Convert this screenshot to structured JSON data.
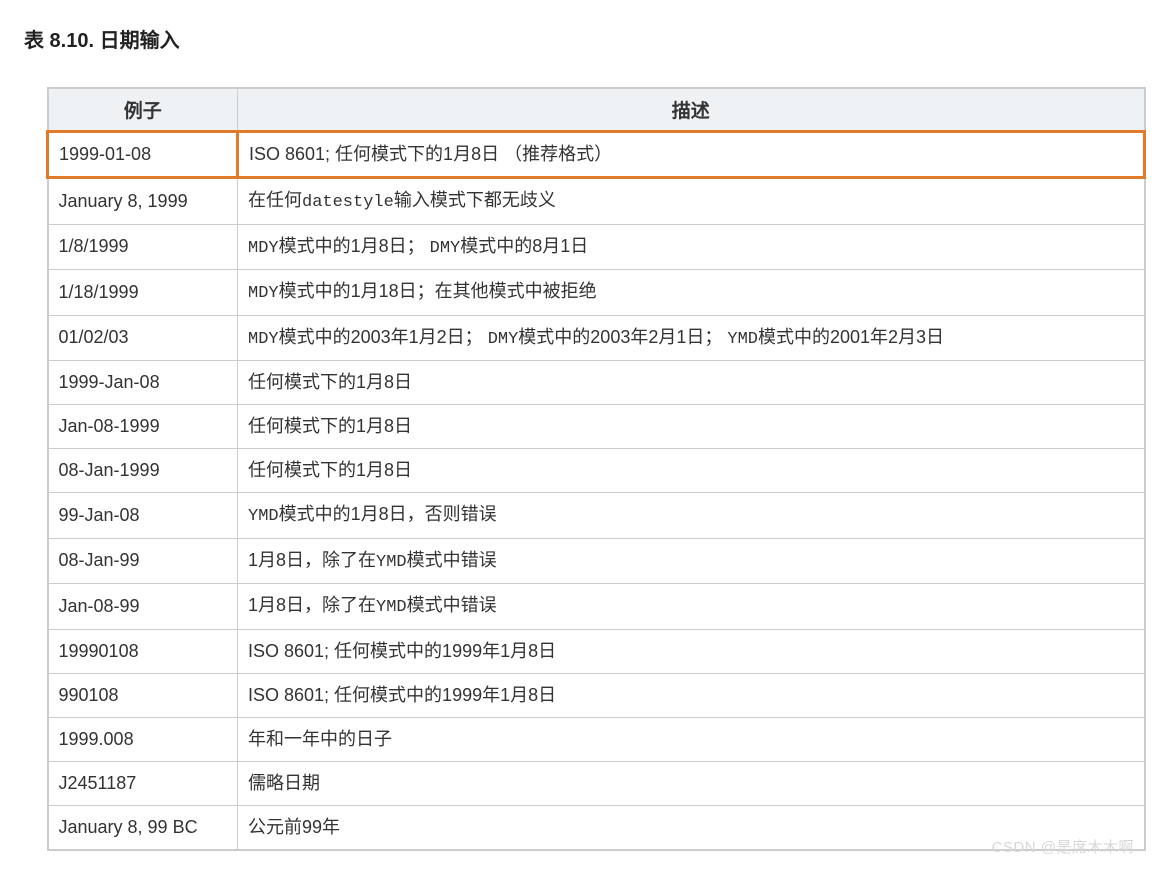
{
  "title": "表 8.10. 日期输入",
  "headers": {
    "example": "例子",
    "description": "描述"
  },
  "rows": [
    {
      "example": "1999-01-08",
      "desc": [
        {
          "t": "ISO 8601; 任何模式下的1月8日 （推荐格式）"
        }
      ],
      "highlight": true
    },
    {
      "example": "January 8, 1999",
      "desc": [
        {
          "t": "在任何"
        },
        {
          "t": "datestyle",
          "code": true
        },
        {
          "t": "输入模式下都无歧义"
        }
      ]
    },
    {
      "example": "1/8/1999",
      "desc": [
        {
          "t": "MDY",
          "code": true
        },
        {
          "t": "模式中的1月8日； "
        },
        {
          "t": "DMY",
          "code": true
        },
        {
          "t": "模式中的8月1日"
        }
      ]
    },
    {
      "example": "1/18/1999",
      "desc": [
        {
          "t": "MDY",
          "code": true
        },
        {
          "t": "模式中的1月18日；在其他模式中被拒绝"
        }
      ]
    },
    {
      "example": "01/02/03",
      "desc": [
        {
          "t": "MDY",
          "code": true
        },
        {
          "t": "模式中的2003年1月2日； "
        },
        {
          "t": "DMY",
          "code": true
        },
        {
          "t": "模式中的2003年2月1日； "
        },
        {
          "t": "YMD",
          "code": true
        },
        {
          "t": "模式中的2001年2月3日"
        }
      ]
    },
    {
      "example": "1999-Jan-08",
      "desc": [
        {
          "t": "任何模式下的1月8日"
        }
      ]
    },
    {
      "example": "Jan-08-1999",
      "desc": [
        {
          "t": "任何模式下的1月8日"
        }
      ]
    },
    {
      "example": "08-Jan-1999",
      "desc": [
        {
          "t": "任何模式下的1月8日"
        }
      ]
    },
    {
      "example": "99-Jan-08",
      "desc": [
        {
          "t": "YMD",
          "code": true
        },
        {
          "t": "模式中的1月8日，否则错误"
        }
      ]
    },
    {
      "example": "08-Jan-99",
      "desc": [
        {
          "t": "1月8日，除了在"
        },
        {
          "t": "YMD",
          "code": true
        },
        {
          "t": "模式中错误"
        }
      ]
    },
    {
      "example": "Jan-08-99",
      "desc": [
        {
          "t": "1月8日，除了在"
        },
        {
          "t": "YMD",
          "code": true
        },
        {
          "t": "模式中错误"
        }
      ]
    },
    {
      "example": "19990108",
      "desc": [
        {
          "t": "ISO 8601; 任何模式中的1999年1月8日"
        }
      ]
    },
    {
      "example": "990108",
      "desc": [
        {
          "t": "ISO 8601; 任何模式中的1999年1月8日"
        }
      ]
    },
    {
      "example": "1999.008",
      "desc": [
        {
          "t": "年和一年中的日子"
        }
      ]
    },
    {
      "example": "J2451187",
      "desc": [
        {
          "t": "儒略日期"
        }
      ]
    },
    {
      "example": "January 8, 99 BC",
      "desc": [
        {
          "t": "公元前99年"
        }
      ]
    }
  ],
  "watermark": "CSDN @是席木木啊"
}
